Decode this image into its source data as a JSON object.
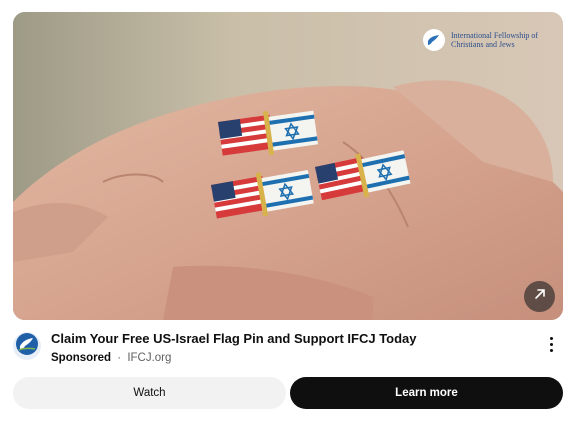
{
  "ad": {
    "title": "Claim Your Free US-Israel Flag Pin and Support IFCJ Today",
    "sponsored_label": "Sponsored",
    "separator": "·",
    "domain": "IFCJ.org",
    "brand_overlay_text": "International Fellowship of Christians and Jews",
    "watch_label": "Watch",
    "learn_more_label": "Learn more"
  },
  "icons": {
    "open": "arrow-up-right-icon",
    "more": "more-vertical-icon",
    "avatar": "dove-logo-icon"
  },
  "colors": {
    "title": "#0f0f0f",
    "meta": "#606060",
    "watch_bg": "#f2f2f2",
    "learn_bg": "#0f0f0f",
    "brand_blue": "#2b4f8c"
  }
}
